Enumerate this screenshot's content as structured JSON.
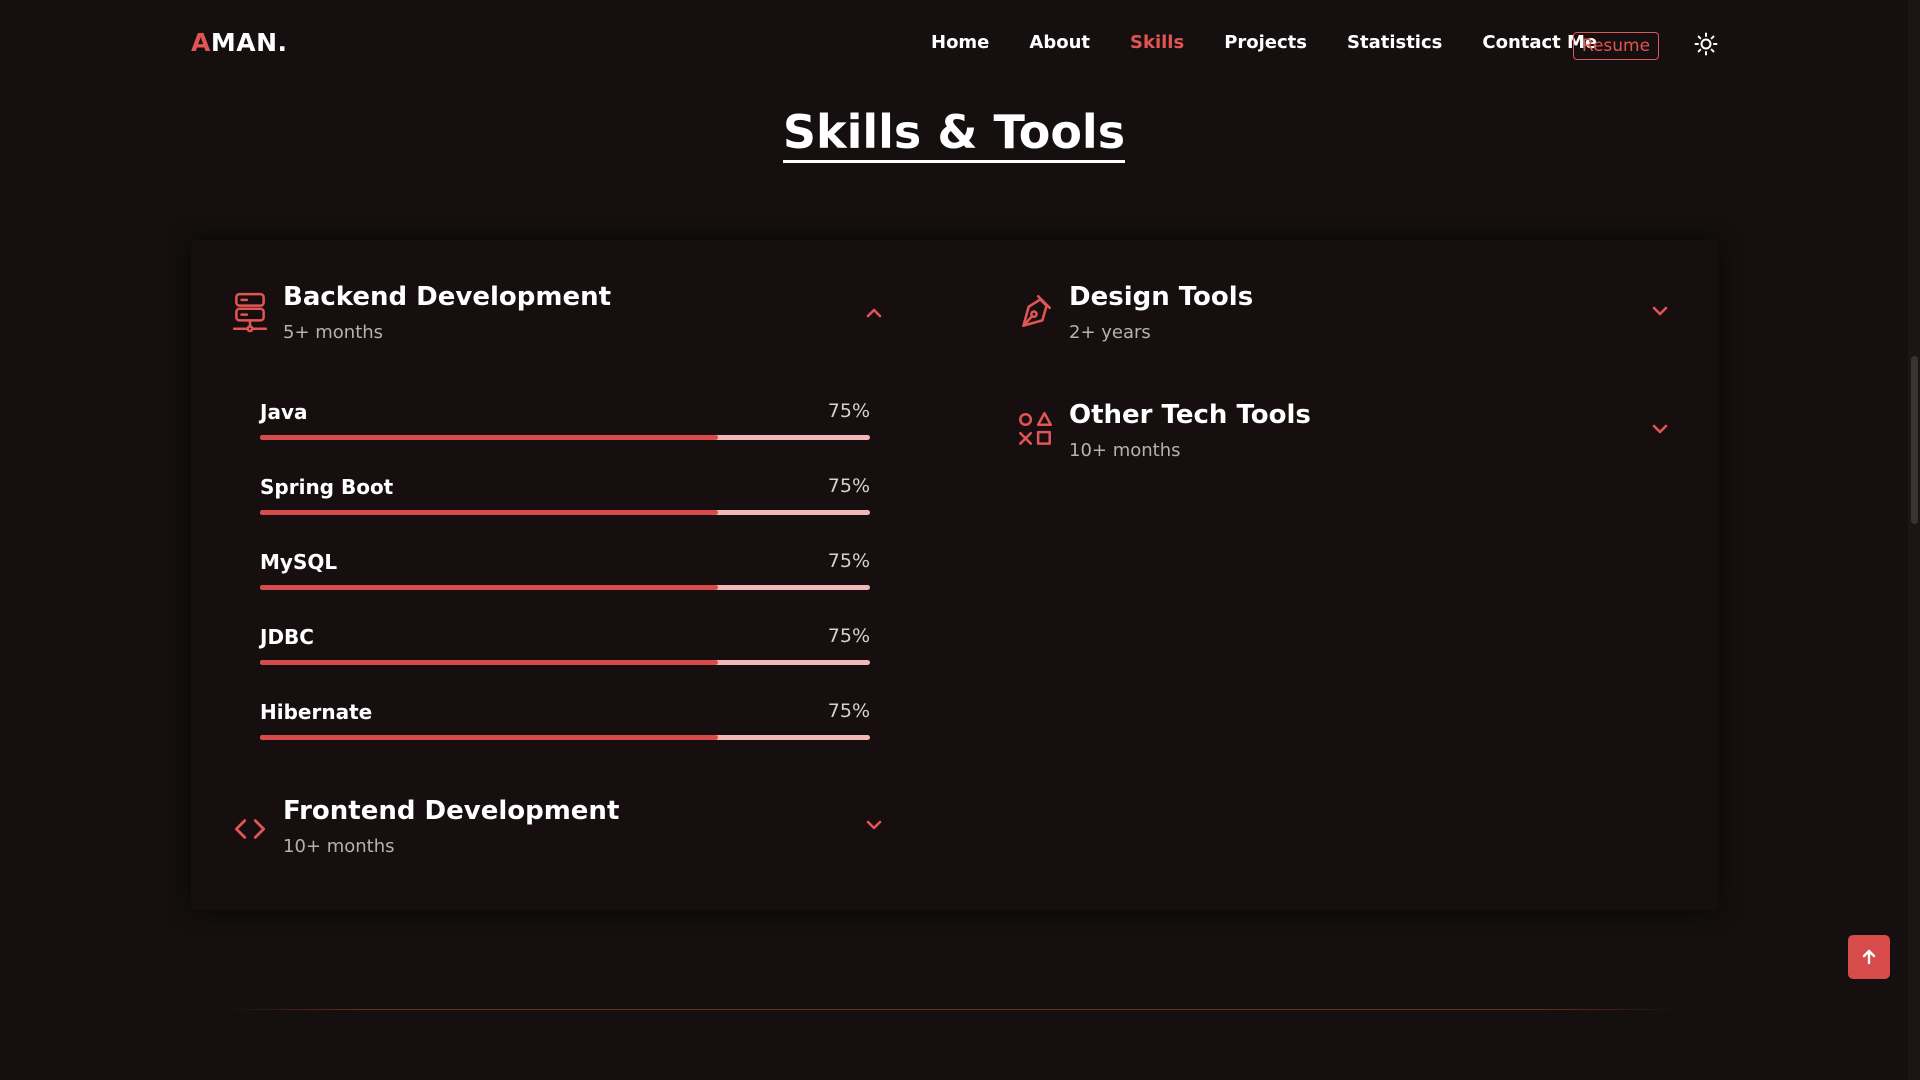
{
  "header": {
    "logo_first": "A",
    "logo_rest": "MAN.",
    "nav": [
      "Home",
      "About",
      "Skills",
      "Projects",
      "Statistics",
      "Contact Me"
    ],
    "active_nav": "Skills",
    "resume_label": "Resume",
    "theme_icon": "sun-icon"
  },
  "section": {
    "title": "Skills & Tools"
  },
  "groups": {
    "backend": {
      "title": "Backend Development",
      "subtitle": "5+ months",
      "icon": "server-icon",
      "expanded": true,
      "skills": [
        {
          "name": "Java",
          "percent_label": "75%",
          "percent": 75
        },
        {
          "name": "Spring Boot",
          "percent_label": "75%",
          "percent": 75
        },
        {
          "name": "MySQL",
          "percent_label": "75%",
          "percent": 75
        },
        {
          "name": "JDBC",
          "percent_label": "75%",
          "percent": 75
        },
        {
          "name": "Hibernate",
          "percent_label": "75%",
          "percent": 75
        }
      ]
    },
    "frontend": {
      "title": "Frontend Development",
      "subtitle": "10+ months",
      "icon": "code-icon",
      "expanded": false
    },
    "design": {
      "title": "Design Tools",
      "subtitle": "2+ years",
      "icon": "pen-tool-icon",
      "expanded": false
    },
    "other": {
      "title": "Other Tech Tools",
      "subtitle": "10+ months",
      "icon": "shapes-icon",
      "expanded": false
    }
  },
  "colors": {
    "accent": "#e25555",
    "bar_fill": "#d84b4b",
    "bar_track": "#f2b8b8",
    "background": "#150f0f"
  },
  "scroll_to_top_icon": "arrow-up-icon"
}
